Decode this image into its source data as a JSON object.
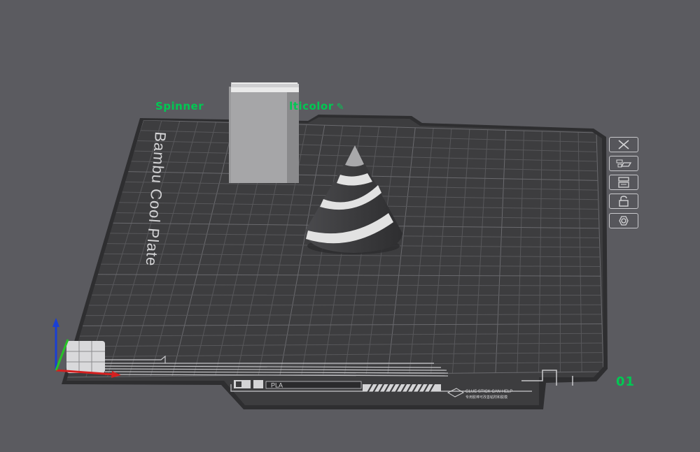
{
  "plate": {
    "name_left": "Spinner",
    "name_right": "lticolor",
    "number": "01",
    "bed_name": "Bambu Cool Plate",
    "filament_label": "PLA",
    "hint_line1": "GLUE STICK CAN HELP",
    "hint_line2": "专用胶棒可改善粘附和脱模"
  },
  "plate_buttons": [
    {
      "name": "close-plate-button",
      "icon": "close-icon"
    },
    {
      "name": "arrange-plate-button",
      "icon": "arrange-icon"
    },
    {
      "name": "orient-plate-button",
      "icon": "layout-icon"
    },
    {
      "name": "lock-plate-button",
      "icon": "lock-icon"
    },
    {
      "name": "plate-settings-button",
      "icon": "settings-icon"
    }
  ],
  "colors": {
    "background": "#5b5b60",
    "bed": "#3d3d3f",
    "grid": "#58585b",
    "plate_label": "#00c853",
    "model_dark": "#3e3e40",
    "model_light": "#d9d9d9"
  }
}
